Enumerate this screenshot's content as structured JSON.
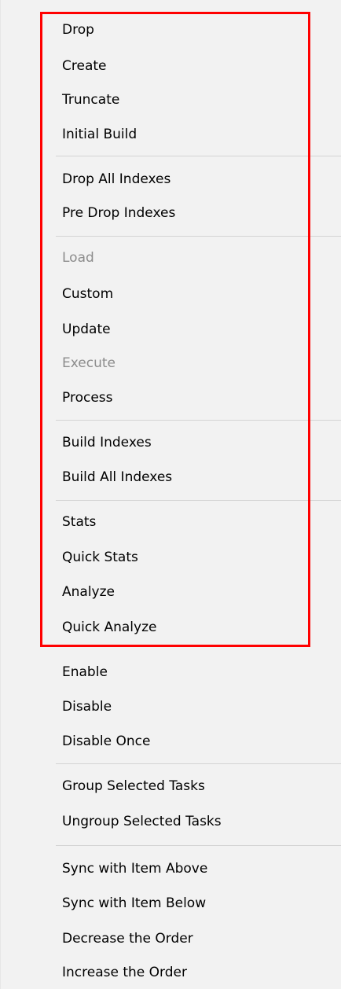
{
  "menu": {
    "items": [
      {
        "label": "Drop",
        "enabled": true
      },
      {
        "label": "Create",
        "enabled": true
      },
      {
        "label": "Truncate",
        "enabled": true
      },
      {
        "label": "Initial Build",
        "enabled": true
      },
      {
        "label": "Drop All Indexes",
        "enabled": true
      },
      {
        "label": "Pre Drop Indexes",
        "enabled": true
      },
      {
        "label": "Load",
        "enabled": false
      },
      {
        "label": "Custom",
        "enabled": true
      },
      {
        "label": "Update",
        "enabled": true
      },
      {
        "label": "Execute",
        "enabled": false
      },
      {
        "label": "Process",
        "enabled": true
      },
      {
        "label": "Build Indexes",
        "enabled": true
      },
      {
        "label": "Build All Indexes",
        "enabled": true
      },
      {
        "label": "Stats",
        "enabled": true
      },
      {
        "label": "Quick Stats",
        "enabled": true
      },
      {
        "label": "Analyze",
        "enabled": true
      },
      {
        "label": "Quick Analyze",
        "enabled": true
      },
      {
        "label": "Enable",
        "enabled": true
      },
      {
        "label": "Disable",
        "enabled": true
      },
      {
        "label": "Disable Once",
        "enabled": true
      },
      {
        "label": "Group Selected Tasks",
        "enabled": true
      },
      {
        "label": "Ungroup Selected Tasks",
        "enabled": true
      },
      {
        "label": "Sync with Item Above",
        "enabled": true
      },
      {
        "label": "Sync with Item Below",
        "enabled": true
      },
      {
        "label": "Decrease the Order",
        "enabled": true
      },
      {
        "label": "Increase the Order",
        "enabled": true
      }
    ],
    "highlight_color": "#ff0000",
    "disabled_text_color": "#8c8c8c",
    "background_color": "#f2f2f2",
    "separator_color": "#d4d4d4"
  }
}
